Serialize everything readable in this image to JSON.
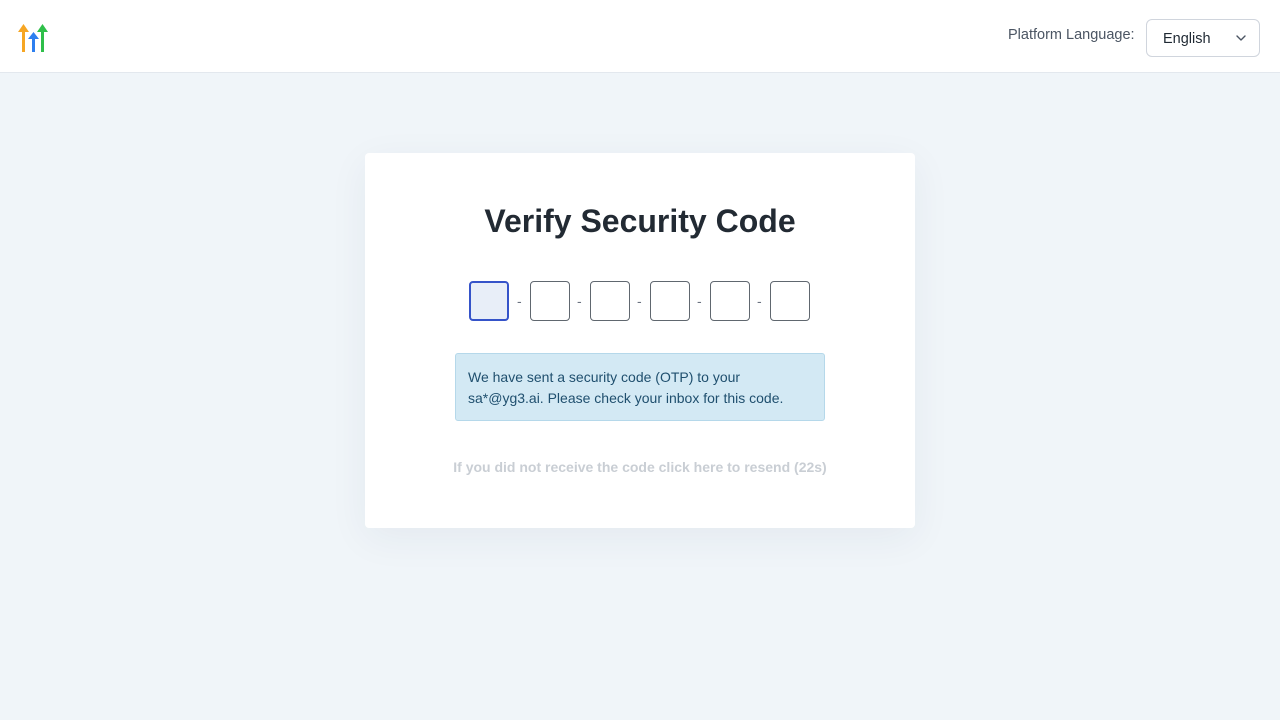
{
  "header": {
    "logo_icon": "growth-arrows-logo",
    "language_label": "Platform Language:",
    "language_value": "English"
  },
  "card": {
    "title": "Verify Security Code",
    "otp": {
      "digit_count": 6,
      "values": [
        "",
        "",
        "",
        "",
        "",
        ""
      ],
      "separator": "-"
    },
    "notice_text": "We have sent a security code (OTP) to your sa*@yg3.ai. Please check your inbox for this code.",
    "resend_text": "If you did not receive the code click here to resend (22s)"
  },
  "colors": {
    "background": "#f0f5f9",
    "active_input_border": "#3553c9",
    "notice_background": "#d3e9f4",
    "resend_disabled": "#c9ced4"
  }
}
